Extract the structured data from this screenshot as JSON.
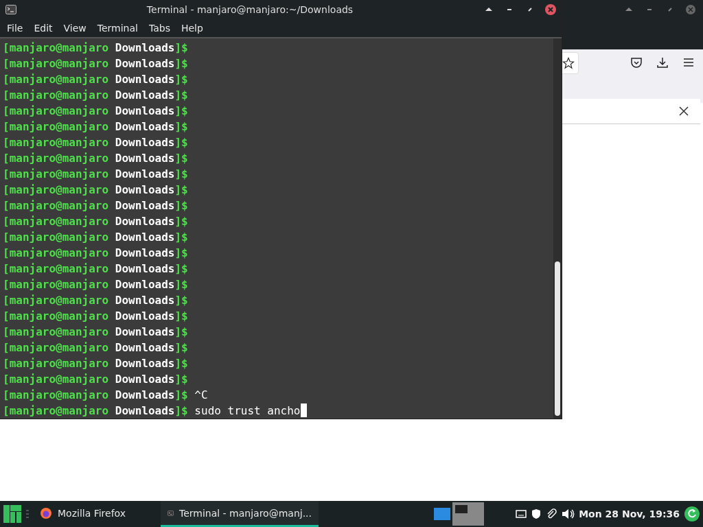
{
  "terminal": {
    "title": "Terminal - manjaro@manjaro:~/Downloads",
    "menu": [
      "File",
      "Edit",
      "View",
      "Terminal",
      "Tabs",
      "Help"
    ],
    "lines": [
      {
        "user": "[manjaro@manjaro",
        "dir": "Downloads",
        "end": "]$"
      },
      {
        "user": "[manjaro@manjaro",
        "dir": "Downloads",
        "end": "]$"
      },
      {
        "user": "[manjaro@manjaro",
        "dir": "Downloads",
        "end": "]$"
      },
      {
        "user": "[manjaro@manjaro",
        "dir": "Downloads",
        "end": "]$"
      },
      {
        "user": "[manjaro@manjaro",
        "dir": "Downloads",
        "end": "]$"
      },
      {
        "user": "[manjaro@manjaro",
        "dir": "Downloads",
        "end": "]$"
      },
      {
        "user": "[manjaro@manjaro",
        "dir": "Downloads",
        "end": "]$"
      },
      {
        "user": "[manjaro@manjaro",
        "dir": "Downloads",
        "end": "]$"
      },
      {
        "user": "[manjaro@manjaro",
        "dir": "Downloads",
        "end": "]$"
      },
      {
        "user": "[manjaro@manjaro",
        "dir": "Downloads",
        "end": "]$"
      },
      {
        "user": "[manjaro@manjaro",
        "dir": "Downloads",
        "end": "]$"
      },
      {
        "user": "[manjaro@manjaro",
        "dir": "Downloads",
        "end": "]$"
      },
      {
        "user": "[manjaro@manjaro",
        "dir": "Downloads",
        "end": "]$"
      },
      {
        "user": "[manjaro@manjaro",
        "dir": "Downloads",
        "end": "]$"
      },
      {
        "user": "[manjaro@manjaro",
        "dir": "Downloads",
        "end": "]$"
      },
      {
        "user": "[manjaro@manjaro",
        "dir": "Downloads",
        "end": "]$"
      },
      {
        "user": "[manjaro@manjaro",
        "dir": "Downloads",
        "end": "]$"
      },
      {
        "user": "[manjaro@manjaro",
        "dir": "Downloads",
        "end": "]$"
      },
      {
        "user": "[manjaro@manjaro",
        "dir": "Downloads",
        "end": "]$"
      },
      {
        "user": "[manjaro@manjaro",
        "dir": "Downloads",
        "end": "]$"
      },
      {
        "user": "[manjaro@manjaro",
        "dir": "Downloads",
        "end": "]$"
      },
      {
        "user": "[manjaro@manjaro",
        "dir": "Downloads",
        "end": "]$"
      },
      {
        "user": "[manjaro@manjaro",
        "dir": "Downloads",
        "end": "]$",
        "command": "^C"
      },
      {
        "user": "[manjaro@manjaro",
        "dir": "Downloads",
        "end": "]$",
        "command": "sudo trust ancho",
        "cursor": true
      }
    ]
  },
  "taskbar": {
    "tasks": [
      {
        "kind": "firefox",
        "label": "Mozilla Firefox",
        "selected": false
      },
      {
        "kind": "terminal",
        "label": "Terminal - manjaro@manj...",
        "selected": true
      }
    ],
    "clock": "Mon 28 Nov, 19:36"
  }
}
